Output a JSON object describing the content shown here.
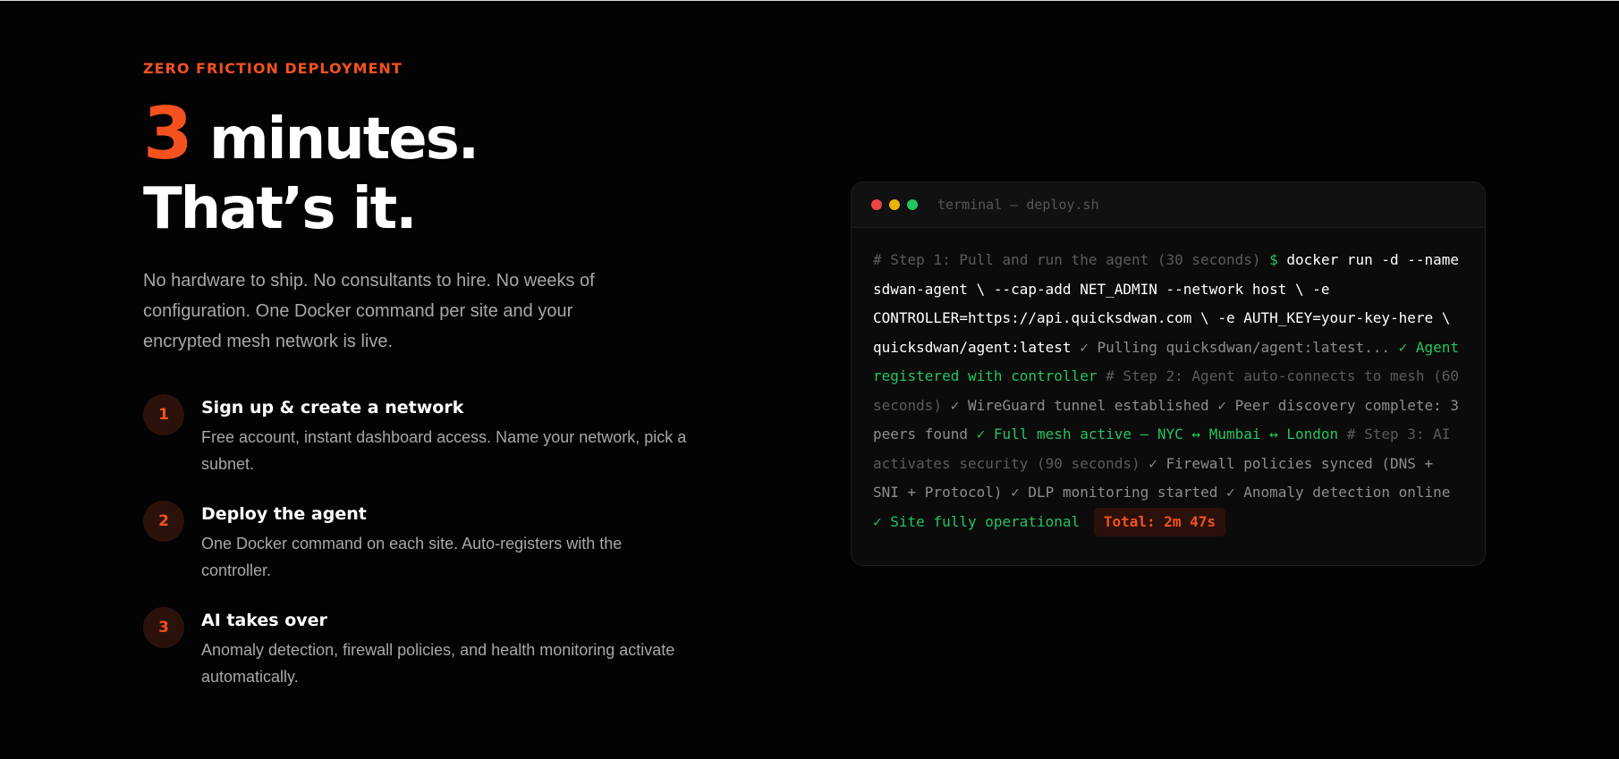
{
  "eyebrow": "ZERO FRICTION DEPLOYMENT",
  "headline": {
    "number": "3",
    "line1_rest": " minutes.",
    "line2": "That’s it."
  },
  "lead": "No hardware to ship. No consultants to hire. No weeks of configuration. One Docker command per site and your encrypted mesh network is live.",
  "steps": [
    {
      "number": "1",
      "title": "Sign up & create a network",
      "desc": "Free account, instant dashboard access. Name your network, pick a subnet."
    },
    {
      "number": "2",
      "title": "Deploy the agent",
      "desc": "One Docker command on each site. Auto-registers with the controller."
    },
    {
      "number": "3",
      "title": "AI takes over",
      "desc": "Anomaly detection, firewall policies, and health monitoring activate automatically."
    }
  ],
  "terminal": {
    "title": "terminal — deploy.sh",
    "step1_comment": "# Step 1: Pull and run the agent (30 seconds)",
    "prompt": "$",
    "command": "docker run -d --name sdwan-agent \\ --cap-add NET_ADMIN --network host \\ -e CONTROLLER=https://api.quicksdwan.com \\ -e AUTH_KEY=your-key-here \\ quicksdwan/agent:latest",
    "out_pulling": "✓ Pulling quicksdwan/agent:latest...",
    "ok_registered": "✓ Agent registered with controller",
    "step2_comment": "# Step 2: Agent auto-connects to mesh (60 seconds)",
    "out_tunnel": "✓ WireGuard tunnel established",
    "out_peers": "✓ Peer discovery complete: 3 peers found",
    "ok_mesh": "✓ Full mesh active — NYC ↔ Mumbai ↔ London",
    "step3_comment": "# Step 3: AI activates security (90 seconds)",
    "out_firewall": "✓ Firewall policies synced (DNS + SNI + Protocol)",
    "out_dlp": "✓ DLP monitoring started",
    "out_anomaly": "✓ Anomaly detection online",
    "ok_site": "✓ Site fully operational",
    "total": "Total: 2m 47s"
  },
  "colors": {
    "accent": "#f4511e",
    "background": "#030303",
    "success": "#22c55e",
    "muted_text": "#a7a7a7"
  }
}
